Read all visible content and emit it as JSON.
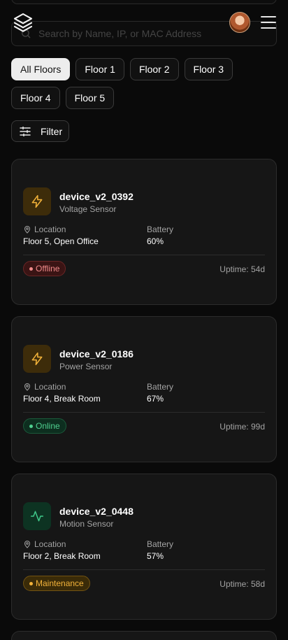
{
  "search": {
    "placeholder": "Search by Name, IP, or MAC Address"
  },
  "floors": [
    "All Floors",
    "Floor 1",
    "Floor 2",
    "Floor 3",
    "Floor 4",
    "Floor 5"
  ],
  "filter": {
    "label": "Filter"
  },
  "devices": [
    {
      "name": "device_v2_0392",
      "type": "Voltage Sensor",
      "icon": "bolt-icon",
      "location_label": "Location",
      "location": "Floor 5, Open Office",
      "battery_label": "Battery",
      "battery": "60%",
      "status": "Offline",
      "uptime": "Uptime: 54d"
    },
    {
      "name": "device_v2_0186",
      "type": "Power Sensor",
      "icon": "bolt-icon",
      "location_label": "Location",
      "location": "Floor 4, Break Room",
      "battery_label": "Battery",
      "battery": "67%",
      "status": "Online",
      "uptime": "Uptime: 99d"
    },
    {
      "name": "device_v2_0448",
      "type": "Motion Sensor",
      "icon": "activity-icon",
      "location_label": "Location",
      "location": "Floor 2, Break Room",
      "battery_label": "Battery",
      "battery": "57%",
      "status": "Maintenance",
      "uptime": "Uptime: 58d"
    }
  ],
  "colors": {
    "background": "#0a0a0a",
    "card": "#161616",
    "offline": "#f08a8a",
    "online": "#4fd08f",
    "maintenance": "#f3b33a",
    "amber_icon": "#f3b33a",
    "green_icon": "#3fc98a"
  }
}
